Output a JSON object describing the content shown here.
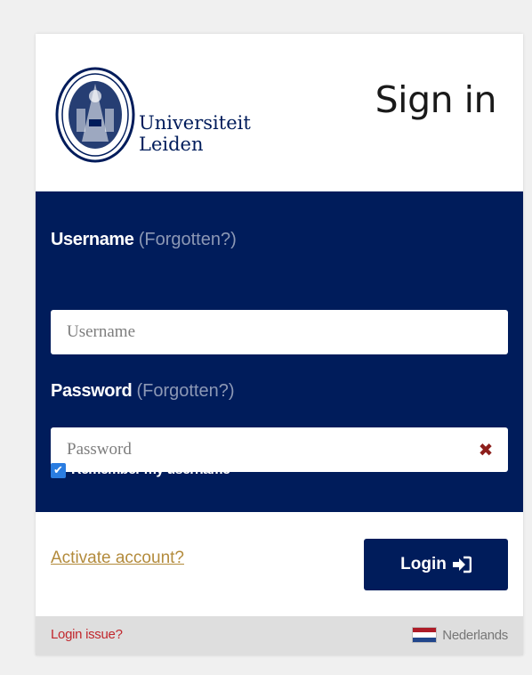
{
  "brand": {
    "line1": "Universiteit",
    "line2": "Leiden"
  },
  "header": {
    "title": "Sign in"
  },
  "form": {
    "username_label": "Username",
    "username_forgotten": "(Forgotten?)",
    "username_placeholder": "Username",
    "username_value": "",
    "password_label": "Password",
    "password_forgotten": "(Forgotten?)",
    "password_placeholder": "Password",
    "password_value": "",
    "remember_label": "Remember my username",
    "remember_checked": true,
    "clear_glyph": "✖",
    "check_glyph": "✔"
  },
  "actions": {
    "activate_link": "Activate account?",
    "login_label": "Login"
  },
  "footer": {
    "issue_link": "Login issue?",
    "language": "Nederlands"
  },
  "icons": {
    "logo": "university-seal-icon",
    "login": "sign-in-arrow-icon",
    "clear": "close-icon",
    "flag": "netherlands-flag-icon"
  },
  "colors": {
    "brand_navy": "#001c5b",
    "link_gold": "#b38b3c",
    "error_red": "#c1272d",
    "checkbox_blue": "#2a7de1",
    "flag": [
      "#ae1c28",
      "#ffffff",
      "#21468b"
    ]
  }
}
